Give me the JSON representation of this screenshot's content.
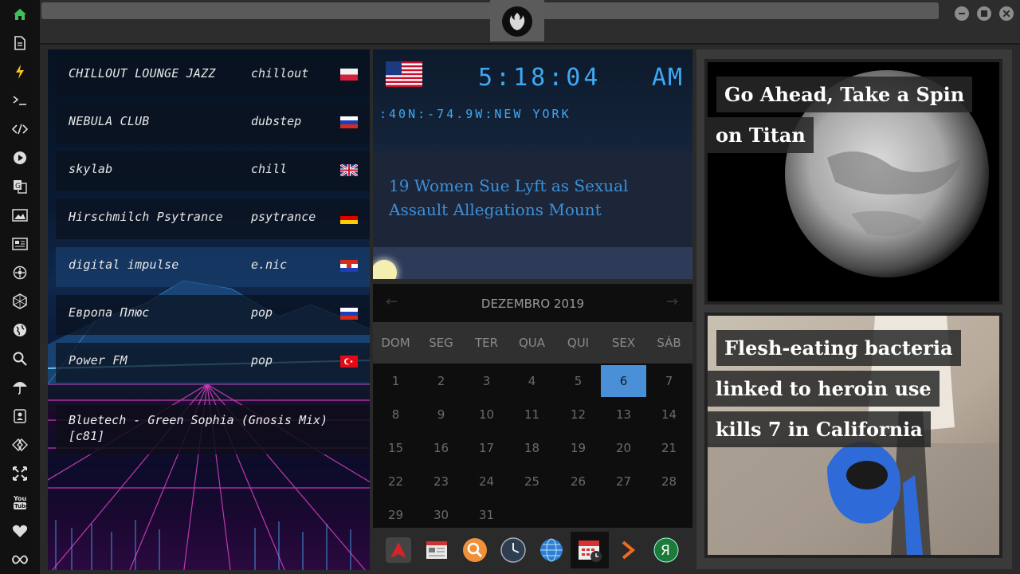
{
  "sidebar": {
    "icons": [
      "home-icon",
      "document-icon",
      "bolt-icon",
      "terminal-icon",
      "code-icon",
      "play-icon",
      "translate-icon",
      "image-icon",
      "news-icon",
      "settings-icon",
      "hexagon-icon",
      "globe-icon",
      "search-icon",
      "umbrella-icon",
      "contact-icon",
      "tag-icon",
      "expand-icon",
      "youtube-icon",
      "heart-icon",
      "infinity-icon"
    ]
  },
  "radio": {
    "stations": [
      {
        "name": "CHILLOUT LOUNGE JAZZ",
        "genre": "chillout",
        "flag": "PL"
      },
      {
        "name": "NEBULA CLUB",
        "genre": "dubstep",
        "flag": "RU"
      },
      {
        "name": "skylab",
        "genre": "chill",
        "flag": "GB"
      },
      {
        "name": "Hirschmilch Psytrance",
        "genre": "psytrance",
        "flag": "DE"
      },
      {
        "name": "digital impulse",
        "genre": "e.nic",
        "flag": "HR"
      },
      {
        "name": "Европа Плюс",
        "genre": "pop",
        "flag": "RU"
      },
      {
        "name": "Power FM",
        "genre": "pop",
        "flag": "TR"
      }
    ],
    "now_playing": "Bluetech - Green Sophia (Gnosis Mix) [c81]"
  },
  "clock": {
    "time": "5:18:04",
    "ampm": "AM",
    "location": ":40N:-74.9W:NEW YORK"
  },
  "news_headline": "19 Women Sue Lyft as Sexual Assault Allegations Mount",
  "calendar": {
    "month": "DEZEMBRO 2019",
    "weekdays": [
      "DOM",
      "SEG",
      "TER",
      "QUA",
      "QUI",
      "SEX",
      "SÁB"
    ],
    "days": [
      "1",
      "2",
      "3",
      "4",
      "5",
      "6",
      "7",
      "8",
      "9",
      "10",
      "11",
      "12",
      "13",
      "14",
      "15",
      "16",
      "17",
      "18",
      "19",
      "20",
      "21",
      "22",
      "23",
      "24",
      "25",
      "26",
      "27",
      "28",
      "29",
      "30",
      "31"
    ],
    "today": "6",
    "prev": "←",
    "next": "→"
  },
  "dock": [
    "arch-icon",
    "calendar-news-icon",
    "search-app-icon",
    "clock-icon",
    "globe-app-icon",
    "calendar-app-icon",
    "arrow-app-icon",
    "yandex-icon"
  ],
  "cards": [
    {
      "title_lines": [
        "Go Ahead, Take a Spin",
        "on Titan"
      ]
    },
    {
      "title_lines": [
        "Flesh-eating bacteria",
        "linked to heroin use",
        "kills 7 in California"
      ]
    }
  ],
  "colors": {
    "accent": "#3fa9f5",
    "today": "#4a90d9",
    "headline": "#3d8fd8",
    "home": "#3fbf5a"
  }
}
